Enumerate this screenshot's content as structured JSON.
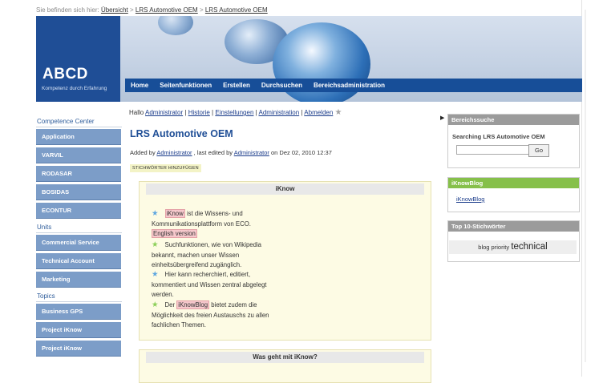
{
  "breadcrumb": {
    "prefix": "Sie befinden sich hier:",
    "items": [
      "Übersicht",
      "LRS Automotive OEM",
      "LRS Automotive OEM"
    ],
    "separator": ">"
  },
  "logo": {
    "title": "ABCD",
    "subtitle": "Kompetenz durch Erfahrung"
  },
  "nav": {
    "items": [
      "Home",
      "Seitenfunktionen",
      "Erstellen",
      "Durchsuchen",
      "Bereichsadministration"
    ]
  },
  "user_links": {
    "greeting": "Hallo",
    "items": [
      "Administrator",
      "Historie",
      "Einstellungen",
      "Administration",
      "Abmelden"
    ],
    "separator": "|"
  },
  "left": {
    "sections": [
      {
        "title": "Competence Center",
        "items": [
          "Application",
          "VARVIL",
          "RODASAR",
          "BOSIDAS",
          "ECONTUR"
        ]
      },
      {
        "title": "Units",
        "items": [
          "Commercial Service",
          "Technical Account",
          "Marketing"
        ]
      },
      {
        "title": "Topics",
        "items": [
          "Business GPS",
          "Project iKnow",
          "Project iKnow"
        ]
      }
    ]
  },
  "page": {
    "title": "LRS Automotive OEM",
    "meta": {
      "added_by": "Added by",
      "author": "Administrator",
      "last_edited": ", last edited by",
      "editor": "Administrator",
      "date": "on Dez 02, 2010 12:37"
    },
    "add_tags": "STICHWÖRTER HINZUFÜGEN"
  },
  "panels": [
    {
      "title": "iKnow",
      "items": [
        {
          "star": "blue",
          "parts": [
            "",
            "iKnow",
            " ist die Wissens- und Kommunikationsplattform von ECO."
          ],
          "extra_link": "English version"
        },
        {
          "star": "green",
          "parts": [
            "Suchfunktionen, wie von Wikipedia bekannt, machen unser Wissen einheitsübergreifend zugänglich.",
            "",
            ""
          ]
        },
        {
          "star": "blue",
          "parts": [
            "Hier kann recherchiert, editiert, kommentiert und Wissen zentral abgelegt werden.",
            "",
            ""
          ]
        },
        {
          "star": "green",
          "parts": [
            "Der ",
            "iKnowBlog",
            " bietet zudem die Möglichkeit des freien Austauschs zu allen fachlichen Themen."
          ]
        }
      ]
    },
    {
      "title": "Was geht mit iKnow?"
    }
  ],
  "right": {
    "search": {
      "title": "Bereichssuche",
      "label": "Searching LRS Automotive OEM",
      "input_value": "",
      "button": "Go"
    },
    "blog": {
      "title": "iKnowBlog",
      "link": "iKnowBlog"
    },
    "tags": {
      "title": "Top 10-Stichwörter",
      "small": "blog priority",
      "big": "technical"
    }
  },
  "colors": {
    "brand_blue": "#1f4e96",
    "sidebar_button": "#7c9dc8",
    "blog_green": "#86c04a",
    "panel_bg": "#fdfbe4",
    "highlight_pink": "#f6c8cc"
  }
}
